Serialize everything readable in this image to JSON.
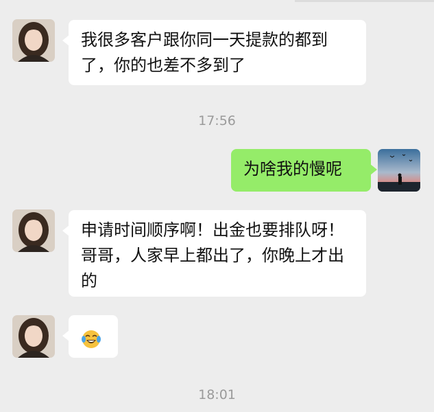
{
  "messages": [
    {
      "id": 1,
      "from": "contact",
      "text": "我很多客户跟你同一天提款的都到了，你的也差不多到了"
    },
    {
      "id": 2,
      "from": "me",
      "text": "为啥我的慢呢"
    },
    {
      "id": 3,
      "from": "contact",
      "text": "申请时间顺序啊！出金也要排队呀！哥哥，人家早上都出了，你晚上才出的"
    },
    {
      "id": 4,
      "from": "contact",
      "emoji": "laughing-crying-emoji"
    }
  ],
  "timestamps": [
    "17:56",
    "18:01"
  ],
  "colors": {
    "background": "#ededed",
    "incoming_bubble": "#ffffff",
    "outgoing_bubble": "#95ec69",
    "timestamp_text": "#9a9a9a"
  },
  "icons": {
    "contact_avatar": "contact-avatar-icon",
    "my_avatar": "user-avatar-icon"
  }
}
